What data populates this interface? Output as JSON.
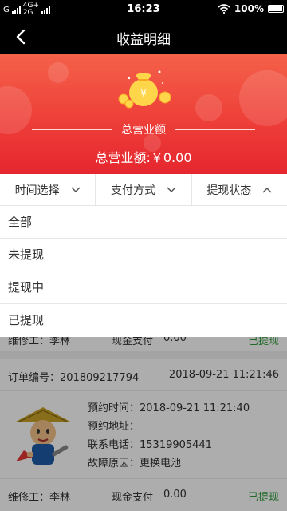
{
  "status_bar": {
    "left_g": "G",
    "left_net_top": "4G+",
    "left_net_bottom": "2G",
    "time": "16:23",
    "battery": "100%"
  },
  "nav": {
    "title": "收益明细",
    "back_icon": "chevron-left-icon"
  },
  "banner": {
    "label": "总营业额",
    "total_text": "总营业额:￥0.00",
    "icon": "money-bag-icon"
  },
  "filters": [
    {
      "label": "时间选择",
      "icon": "chevron-down-icon"
    },
    {
      "label": "支付方式",
      "icon": "chevron-down-icon"
    },
    {
      "label": "提现状态",
      "icon": "chevron-up-icon"
    }
  ],
  "dropdown_options": [
    "全部",
    "未提现",
    "提现中",
    "已提现"
  ],
  "orders_top_partial": {
    "worker_text": "维修工：李林",
    "pay_text": "现金支付",
    "amount": "0.00",
    "status": "已提现"
  },
  "order": {
    "order_no_label": "订单编号：",
    "order_no": "201809217794",
    "order_time": "2018-09-21 11:21:46",
    "appoint_time_label": "预约时间：",
    "appoint_time": "2018-09-21 11:21:40",
    "address_label": "预约地址：",
    "address": "",
    "phone_label": "联系电话：",
    "phone": "15319905441",
    "fault_label": "故障原因：",
    "fault": "更换电池",
    "worker_text": "维修工：李林",
    "pay_text": "现金支付",
    "amount": "0.00",
    "status": "已提现"
  },
  "colors": {
    "banner_top": "#f4614a",
    "banner_bottom": "#e5262f",
    "status_green": "#2e9d3a"
  }
}
